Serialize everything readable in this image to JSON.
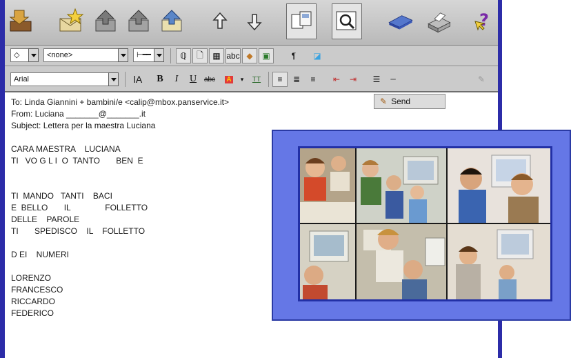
{
  "toolbar": {
    "icons": [
      "send-receive-icon",
      "new-message-icon",
      "reply-icon",
      "reply-all-icon",
      "forward-icon",
      "previous-message-icon",
      "next-message-icon",
      "copy-message-icon",
      "search-icon",
      "address-book-icon",
      "print-icon",
      "help-icon"
    ]
  },
  "format_bar": {
    "style_value": "<none>",
    "send_label": "Send"
  },
  "font_bar": {
    "font_value": "Arial",
    "bold_label": "B",
    "italic_label": "I",
    "underline_label": "U"
  },
  "message": {
    "to": "To: Linda Giannini + bambini/e <calip@mbox.panservice.it>",
    "from": "From: Luciana _______@_______.it",
    "subject": "Subject: Lettera per la maestra Luciana",
    "lines": [
      "CARA MAESTRA    LUCIANA",
      "TI   VO G L I  O  TANTO       BEN  E",
      "",
      "",
      "TI  MANDO   TANTI    BACI",
      "E  BELLO       IL               FOLLETTO",
      "DELLE    PAROLE",
      "TI       SPEDISCO    IL    FOLLETTO",
      "",
      "D EI    NUMERI",
      "",
      "LORENZO",
      "FRANCESCO",
      "RICCARDO",
      "FEDERICO"
    ]
  },
  "colors": {
    "frame_blue": "#6577e6",
    "frame_border": "#2a3aa4",
    "window_border": "#2c2ca8"
  }
}
